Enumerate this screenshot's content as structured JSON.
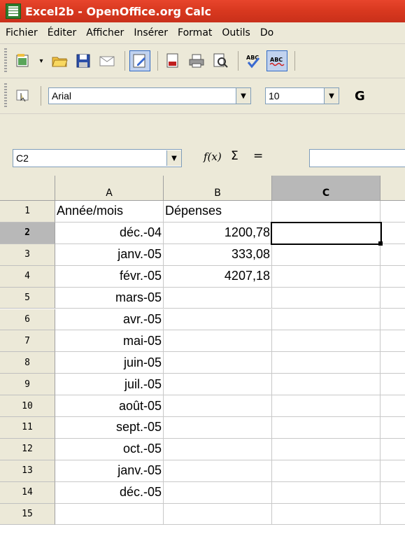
{
  "window": {
    "title": "Excel2b - OpenOffice.org Calc"
  },
  "menu": [
    "Fichier",
    "Éditer",
    "Afficher",
    "Insérer",
    "Format",
    "Outils",
    "Do"
  ],
  "toolbar": {
    "font_name": "Arial",
    "font_size": "10",
    "bold_label": "G"
  },
  "formula": {
    "cell_ref": "C2",
    "sum_symbol": "Σ",
    "equals_symbol": "=",
    "fx_label": "f(x)",
    "value": ""
  },
  "columns": [
    "A",
    "B",
    "C"
  ],
  "rows": [
    {
      "num": "1",
      "a": "Année/mois",
      "b": "Dépenses"
    },
    {
      "num": "2",
      "a": "déc.-04",
      "b": "1200,78"
    },
    {
      "num": "3",
      "a": "janv.-05",
      "b": "333,08"
    },
    {
      "num": "4",
      "a": "févr.-05",
      "b": "4207,18"
    },
    {
      "num": "5",
      "a": "mars-05",
      "b": ""
    },
    {
      "num": "6",
      "a": "avr.-05",
      "b": ""
    },
    {
      "num": "7",
      "a": "mai-05",
      "b": ""
    },
    {
      "num": "8",
      "a": "juin-05",
      "b": ""
    },
    {
      "num": "9",
      "a": "juil.-05",
      "b": ""
    },
    {
      "num": "10",
      "a": "août-05",
      "b": ""
    },
    {
      "num": "11",
      "a": "sept.-05",
      "b": ""
    },
    {
      "num": "12",
      "a": "oct.-05",
      "b": ""
    },
    {
      "num": "13",
      "a": "janv.-05",
      "b": ""
    },
    {
      "num": "14",
      "a": "déc.-05",
      "b": ""
    },
    {
      "num": "15",
      "a": "",
      "b": ""
    }
  ],
  "selection": {
    "column": "C",
    "row": "2"
  }
}
